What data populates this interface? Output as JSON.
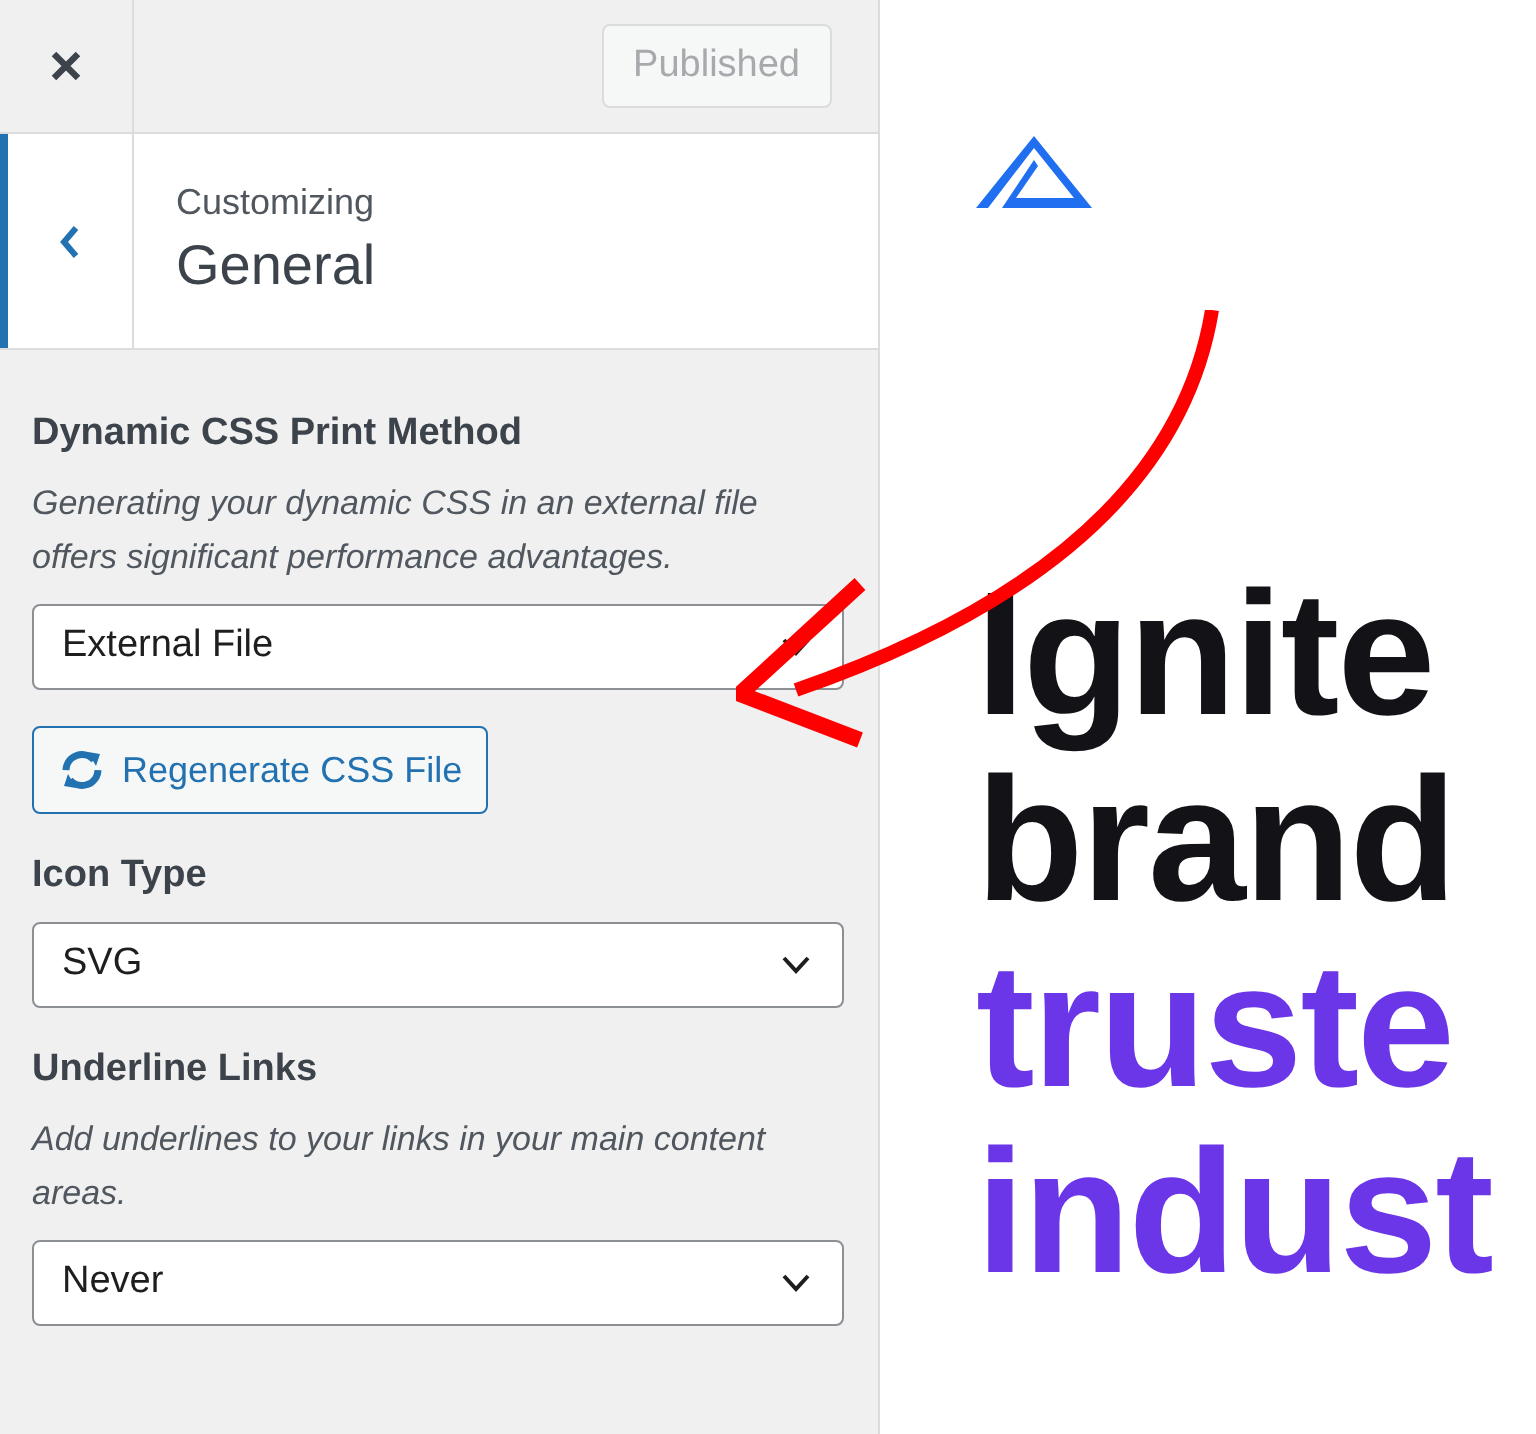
{
  "top_bar": {
    "publish_button": {
      "label": "Published",
      "disabled": true
    }
  },
  "header": {
    "subtitle": "Customizing",
    "title": "General"
  },
  "controls": [
    {
      "kind": "select",
      "label": "Dynamic CSS Print Method",
      "description": "Generating your dynamic CSS in an external file offers significant performance advantages.",
      "value": "External File"
    },
    {
      "kind": "button",
      "label": "Regenerate CSS File"
    },
    {
      "kind": "select",
      "label": "Icon Type",
      "value": "SVG"
    },
    {
      "kind": "select",
      "label": "Underline Links",
      "description": "Add underlines to your links in your main content areas.",
      "value": "Never"
    }
  ],
  "preview": {
    "headline": [
      {
        "text": "Ignite",
        "accent": false
      },
      {
        "text": "brand",
        "accent": false
      },
      {
        "text": "truste",
        "accent": true
      },
      {
        "text": "indust",
        "accent": true
      }
    ]
  }
}
